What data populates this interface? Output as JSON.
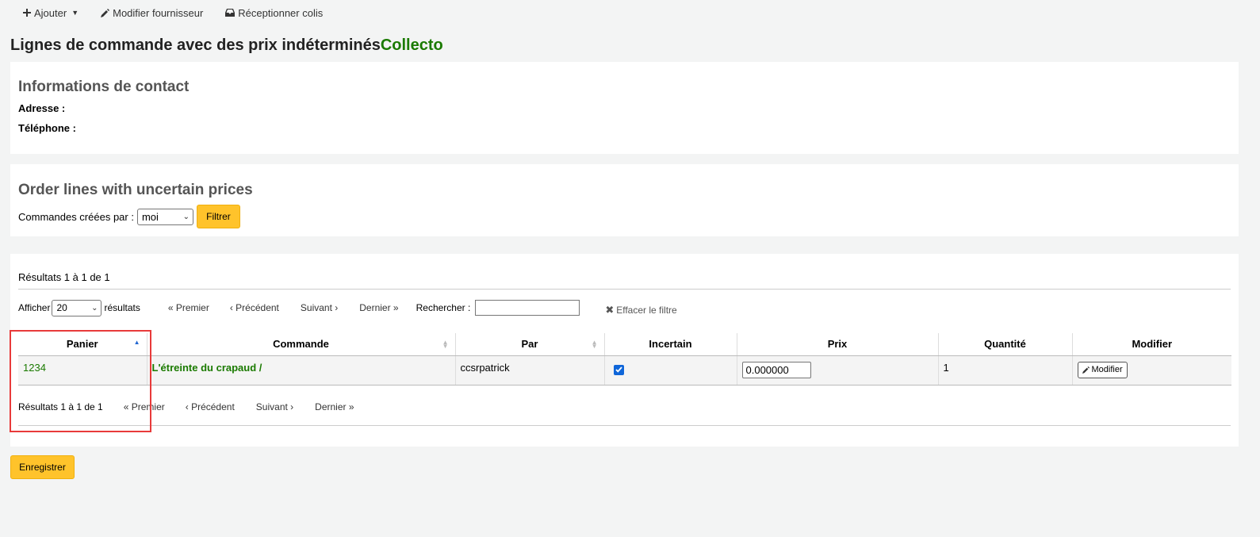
{
  "toolbar": {
    "add_label": "Ajouter",
    "edit_vendor_label": "Modifier fournisseur",
    "receive_label": "Réceptionner colis"
  },
  "page": {
    "title": "Lignes de commande avec des prix indéterminés",
    "vendor": "Collecto"
  },
  "contact": {
    "heading": "Informations de contact",
    "address_label": "Adresse :",
    "phone_label": "Téléphone :"
  },
  "filter": {
    "heading": "Order lines with uncertain prices",
    "created_by_label": "Commandes créées par :",
    "created_by_value": "moi",
    "submit_label": "Filtrer"
  },
  "results": {
    "summary": "Résultats 1 à 1 de 1",
    "show_label": "Afficher",
    "page_size": "20",
    "results_label": "résultats",
    "first": "« Premier",
    "previous": "‹ Précédent",
    "next": "Suivant ›",
    "last": "Dernier »",
    "search_label": "Rechercher :",
    "search_value": "",
    "clear_filter": "Effacer le filtre",
    "columns": [
      "Panier",
      "Commande",
      "Par",
      "Incertain",
      "Prix",
      "Quantité",
      "Modifier"
    ],
    "rows": [
      {
        "basket": "1234",
        "order": "L'étreinte du crapaud /",
        "by": "ccsrpatrick",
        "uncertain": true,
        "price": "0.000000",
        "quantity": "1",
        "edit_label": "Modifier"
      }
    ]
  },
  "save_label": "Enregistrer",
  "colors": {
    "accent_yellow": "#ffc32b",
    "link_green": "#1a7a00",
    "highlight_red": "#e83a3a"
  }
}
